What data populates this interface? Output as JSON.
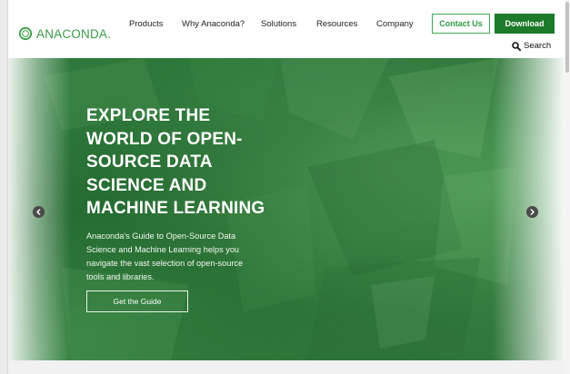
{
  "header": {
    "logo_text": "ANACONDA.",
    "nav": [
      "Products",
      "Why Anaconda?",
      "Solutions",
      "Resources",
      "Company"
    ],
    "contact_label": "Contact Us",
    "download_label": "Download",
    "search_label": "Search"
  },
  "hero": {
    "title": "EXPLORE THE\nWORLD OF OPEN-\nSOURCE DATA\nSCIENCE AND\nMACHINE LEARNING",
    "description": "Anaconda's Guide to Open-Source Data\nScience and Machine Learning helps you\nnavigate the vast selection of open-source\ntools and libraries.",
    "cta_label": "Get the Guide",
    "prev_icon": "chevron-left-icon",
    "next_icon": "chevron-right-icon"
  },
  "colors": {
    "brand_green": "#3a9b49",
    "download_bg": "#1d7a2a",
    "hero_green": "#2f7a3c"
  }
}
